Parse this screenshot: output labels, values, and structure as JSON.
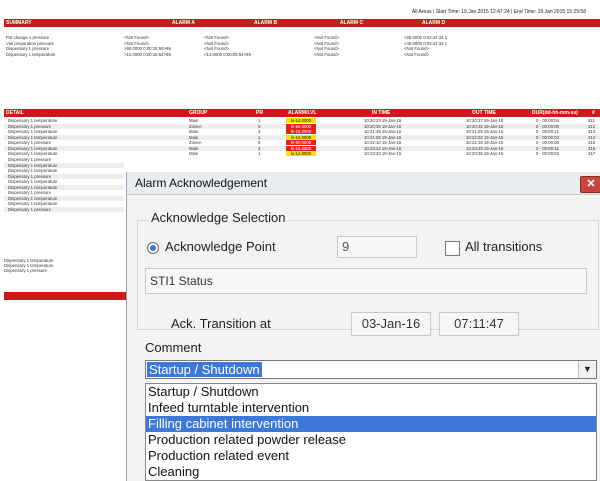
{
  "report": {
    "header_info": "All Areas  |  Start Time: 19.Jan 2015 12:47:24  |  End Time: 19.Jan 2015 15:29:58",
    "summary_header": {
      "title": "SUMMARY",
      "alarm_a": "ALARM A",
      "alarm_b": "ALARM B",
      "alarm_c": "ALARM C",
      "alarm_d": "ALARM D"
    },
    "summary_rows": [
      {
        "name": "Pot change 1 pressure",
        "a": "<Not Found>",
        "b": "<Not Found>",
        "c": "<Not Found>",
        "d": "<25.0000  0:02:42:34  1"
      },
      {
        "name": "Vial preparation pressure",
        "a": "<Not Found>",
        "b": "<Not Found>",
        "c": "<Not Found>",
        "d": "<40.0000  0:02:42:34  1"
      },
      {
        "name": "Dispensary 1 pressure",
        "a": ">90.0000  0:00:16:55>99",
        "b": "<Not Found>",
        "c": "<Not Found>",
        "d": "<Not Found>"
      },
      {
        "name": "Dispensary 1 temperature",
        "a": ">15.0000  0:00:16:54>99",
        "b": "<14.0000  0:00:05:04>99",
        "c": "<Not Found>",
        "d": "<Not Found>"
      }
    ],
    "detail_header": {
      "title": "DETAIL",
      "group": "GROUP",
      "pr": "PR",
      "level": "ALARM/LVL",
      "in_time": "IN TIME",
      "out_time": "OUT TIME",
      "duration": "DUR(dd-hh-mm-ss)",
      "num": "#"
    },
    "detail_rows": [
      {
        "name": "Dispensary 1 temperature",
        "group": "Main",
        "pr": "1",
        "level": "lo-14.0000",
        "color": "y",
        "in": "10:20:23  19-Jan-15",
        "out": "10:20:27  19-Jan-15",
        "dur": "0 - 00:00:04",
        "n": "311"
      },
      {
        "name": "Dispensary 1 pressure",
        "group": "ZoneA",
        "pr": "5",
        "level": "hi-90.0000",
        "color": "r",
        "in": "10:20:39  19-Jan-15",
        "out": "10:20:45  19-Jan-15",
        "dur": "0 - 00:00:06",
        "n": "312"
      },
      {
        "name": "Dispensary 1 temperature",
        "group": "Main",
        "pr": "3",
        "level": "hi-15.0000",
        "color": "r",
        "in": "10:21:48  19-Jan-15",
        "out": "10:21:59  19-Jan-15",
        "dur": "0 - 00:00:11",
        "n": "313"
      },
      {
        "name": "Dispensary 1 temperature",
        "group": "Main",
        "pr": "1",
        "level": "lo-14.0000",
        "color": "y",
        "in": "10:21:59  19-Jan-15",
        "out": "10:22:02  19-Jan-15",
        "dur": "0 - 00:00:03",
        "n": "314"
      },
      {
        "name": "Dispensary 1 pressure",
        "group": "ZoneA",
        "pr": "5",
        "level": "hi-90.0000",
        "color": "r",
        "in": "10:22:10  19-Jan-15",
        "out": "10:22:18  19-Jan-15",
        "dur": "0 - 00:00:08",
        "n": "315"
      },
      {
        "name": "Dispensary 1 temperature",
        "group": "Main",
        "pr": "3",
        "level": "hi-15.0000",
        "color": "r",
        "in": "10:23:22  19-Jan-15",
        "out": "10:23:33  19-Jan-15",
        "dur": "0 - 00:00:11",
        "n": "316"
      },
      {
        "name": "Dispensary 1 temperature",
        "group": "Main",
        "pr": "1",
        "level": "lo-14.0000",
        "color": "y",
        "in": "10:23:33  19-Jan-15",
        "out": "10:23:36  19-Jan-15",
        "dur": "0 - 00:00:03",
        "n": "317"
      }
    ],
    "left_names": [
      "Dispensary 1 pressure",
      "Dispensary 1 temperature",
      "Dispensary 1 temperature",
      "Dispensary 1 pressure",
      "Dispensary 1 temperature",
      "Dispensary 1 temperature",
      "Dispensary 1 pressure",
      "Dispensary 1 temperature",
      "Dispensary 1 temperature",
      "Dispensary 1 pressure"
    ],
    "bottom_names": [
      "Dispensary 1 temperature",
      "Dispensary 1 temperature",
      "Dispensary 1 pressure"
    ]
  },
  "dialog": {
    "title": "Alarm Acknowledgement",
    "close_glyph": "✕",
    "selection_label": "Acknowledge Selection",
    "ack_point_label": "Acknowledge Point",
    "ack_point_value": "9",
    "all_transitions_label": "All transitions",
    "status_text": "STI1 Status",
    "ack_transition_label": "Ack. Transition at",
    "ack_date": "03-Jan-16",
    "ack_time": "07:11:47",
    "comment_label": "Comment",
    "comment_value": "Startup / Shutdown",
    "dropdown_arrow": "▼",
    "options": [
      "Startup / Shutdown",
      "Infeed turntable intervention",
      "Filling cabinet intervention",
      "Production related powder release",
      "Production related event",
      "Cleaning"
    ],
    "highlighted_option": "Filling cabinet intervention"
  }
}
